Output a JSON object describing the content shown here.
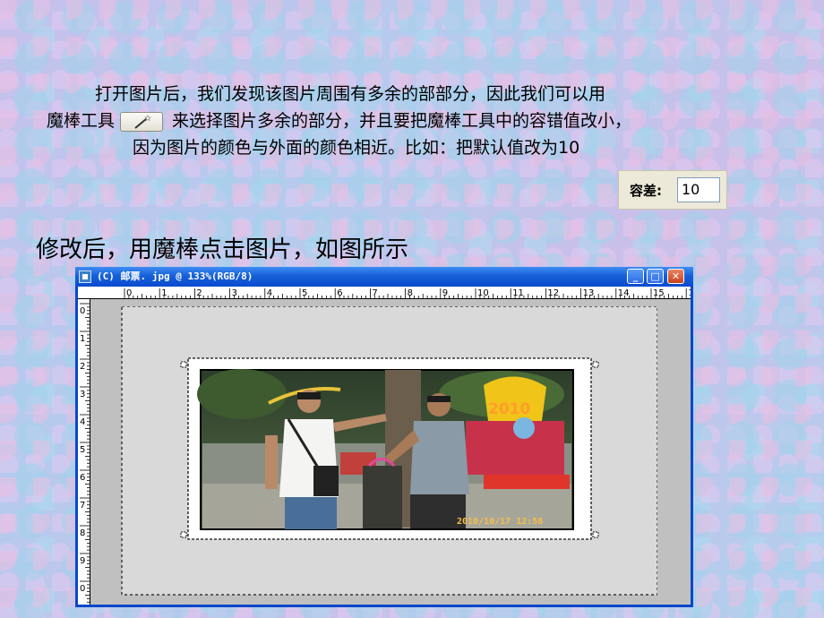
{
  "instructions": {
    "line1": "打开图片后，我们发现该图片周围有多余的部部分，因此我们可以用",
    "line2_a": "魔棒工具",
    "line2_b": "来选择图片多余的部分，并且要把魔棒工具中的容错值改小，",
    "line3": "因为图片的颜色与外面的颜色相近。比如：把默认值改为10"
  },
  "wand_tool": {
    "icon": "magic-wand-icon"
  },
  "tolerance": {
    "label": "容差:",
    "value": "10"
  },
  "heading": "修改后，用魔棒点击图片，如图所示",
  "window": {
    "title": "(C) 邮票. jpg @ 133%(RGB/8)",
    "buttons": {
      "minimize": "_",
      "maximize": "□",
      "close": "✕"
    },
    "ruler_top_labels": [
      "0",
      "1",
      "2",
      "3",
      "4",
      "5",
      "6",
      "7",
      "8",
      "9",
      "10",
      "11",
      "12",
      "13",
      "14",
      "15",
      "1"
    ],
    "ruler_left_labels": [
      "0",
      "1",
      "2",
      "3",
      "4",
      "5",
      "6",
      "7",
      "8",
      "9",
      "0"
    ]
  },
  "photo": {
    "year_text": "2010",
    "timestamp": "2010/10/17 12:58"
  },
  "colors": {
    "titlebar": "#0a4ad0",
    "canvas_bg": "#c0c0c0",
    "image_bg": "#d9d9d9"
  }
}
